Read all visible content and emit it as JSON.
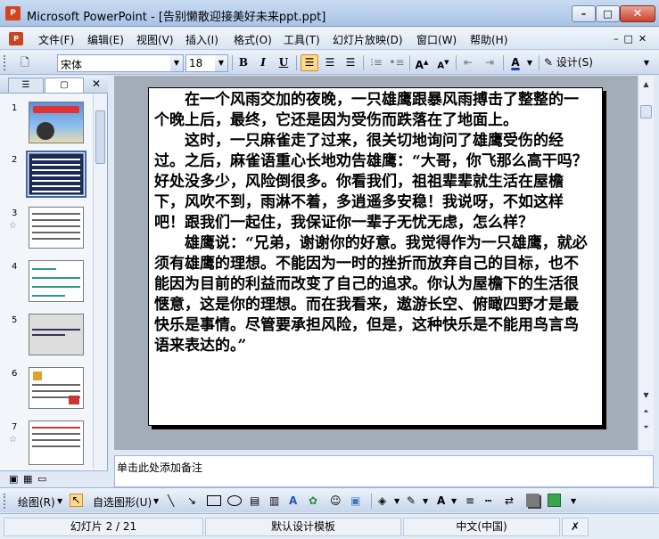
{
  "window": {
    "app_icon": "P",
    "title": "Microsoft PowerPoint - [告别懒散迎接美好未来ppt.ppt]"
  },
  "menu": {
    "items": [
      "文件(F)",
      "编辑(E)",
      "视图(V)",
      "插入(I)",
      "格式(O)",
      "工具(T)",
      "幻灯片放映(D)",
      "窗口(W)",
      "帮助(H)"
    ]
  },
  "toolbar": {
    "font_name": "宋体",
    "font_size": "18",
    "bold": "B",
    "italic": "I",
    "underline": "U",
    "design_label": "设计(S)"
  },
  "thumbnails": [
    {
      "number": "1",
      "has_animation": false
    },
    {
      "number": "2",
      "has_animation": false
    },
    {
      "number": "3",
      "has_animation": true
    },
    {
      "number": "4",
      "has_animation": false
    },
    {
      "number": "5",
      "has_animation": false
    },
    {
      "number": "6",
      "has_animation": false
    },
    {
      "number": "7",
      "has_animation": true
    }
  ],
  "slide": {
    "paragraphs": [
      "在一个风雨交加的夜晚，一只雄鹰跟暴风雨搏击了整整的一个晚上后，最终，它还是因为受伤而跌落在了地面上。",
      "这时，一只麻雀走了过来，很关切地询问了雄鹰受伤的经过。之后，麻雀语重心长地劝告雄鹰：“大哥，你飞那么高干吗？好处没多少，风险倒很多。你看我们，祖祖辈辈就生活在屋檐下，风吹不到，雨淋不着，多逍遥多安稳！我说呀，不如这样吧！跟我们一起住，我保证你一辈子无忧无虑，怎么样？",
      "雄鹰说：“兄弟，谢谢你的好意。我觉得作为一只雄鹰，就必须有雄鹰的理想。不能因为一时的挫折而放弃自己的目标，也不能因为目前的利益而改变了自己的追求。你认为屋檐下的生活很惬意，这是你的理想。而在我看来，遨游长空、俯瞰四野才是最快乐是事情。尽管要承担风险，但是，这种快乐是不能用鸟言鸟语来表达的。”"
    ]
  },
  "notes": {
    "placeholder": "单击此处添加备注"
  },
  "drawbar": {
    "draw_label": "绘图(R)",
    "autoshape_label": "自选图形(U)"
  },
  "status": {
    "slide_position": "幻灯片 2 / 21",
    "template": "默认设计模板",
    "language": "中文(中国)"
  }
}
